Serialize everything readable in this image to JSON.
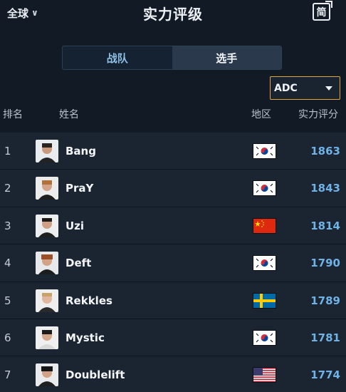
{
  "header": {
    "region": "全球",
    "title": "实力评级",
    "lang_toggle": "简"
  },
  "tabs": [
    {
      "label": "战队",
      "active": false
    },
    {
      "label": "选手",
      "active": true
    }
  ],
  "filter": {
    "role": "ADC"
  },
  "columns": {
    "rank": "排名",
    "name": "姓名",
    "region": "地区",
    "score": "实力评分"
  },
  "colors": {
    "background": "#121a25",
    "row": "#1b2431",
    "score": "#6fb2e6",
    "tab_active": "#2a394c",
    "select_border": "#e4a63b"
  },
  "players": [
    {
      "rank": "1",
      "name": "Bang",
      "flag": "korea-flag-icon",
      "score": "1863"
    },
    {
      "rank": "2",
      "name": "PraY",
      "flag": "korea-flag-icon",
      "score": "1843"
    },
    {
      "rank": "3",
      "name": "Uzi",
      "flag": "china-flag-icon",
      "score": "1814"
    },
    {
      "rank": "4",
      "name": "Deft",
      "flag": "korea-flag-icon",
      "score": "1790"
    },
    {
      "rank": "5",
      "name": "Rekkles",
      "flag": "sweden-flag-icon",
      "score": "1789"
    },
    {
      "rank": "6",
      "name": "Mystic",
      "flag": "korea-flag-icon",
      "score": "1781"
    },
    {
      "rank": "7",
      "name": "Doublelift",
      "flag": "usa-flag-icon",
      "score": "1774"
    }
  ]
}
